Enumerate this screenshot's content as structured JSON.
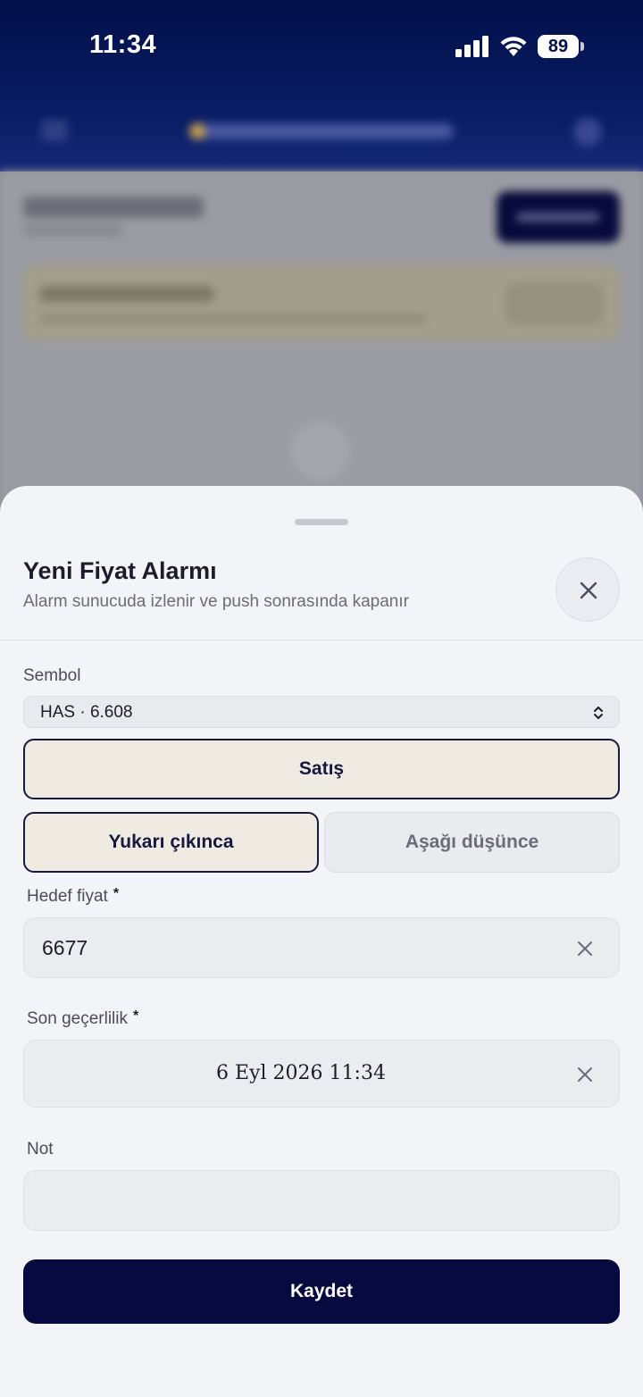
{
  "status_bar": {
    "time": "11:34",
    "battery_level": "89",
    "icons": [
      "signal-icon",
      "wifi-icon",
      "battery-icon"
    ]
  },
  "sheet": {
    "title": "Yeni Fiyat Alarmı",
    "subtitle": "Alarm sunucuda izlenir ve push sonrasında kapanır",
    "close_icon": "close-icon",
    "symbol": {
      "label": "Sembol",
      "value": "HAS · 6.608"
    },
    "side": {
      "label": "Satış",
      "selected": true
    },
    "direction": {
      "options": [
        {
          "label": "Yukarı çıkınca",
          "selected": true
        },
        {
          "label": "Aşağı düşünce",
          "selected": false
        }
      ]
    },
    "target_price": {
      "label": "Hedef fiyat",
      "required_mark": "*",
      "value": "6677"
    },
    "expiry": {
      "label": "Son geçerlilik",
      "required_mark": "*",
      "value": "6 Eyl 2026 11:34"
    },
    "note": {
      "label": "Not",
      "value": ""
    },
    "save_label": "Kaydet"
  },
  "colors": {
    "header_navy": "#02104a",
    "primary_button": "#070a3e",
    "selected_fill": "#efebe3",
    "sheet_bg": "#f3f4f8"
  }
}
